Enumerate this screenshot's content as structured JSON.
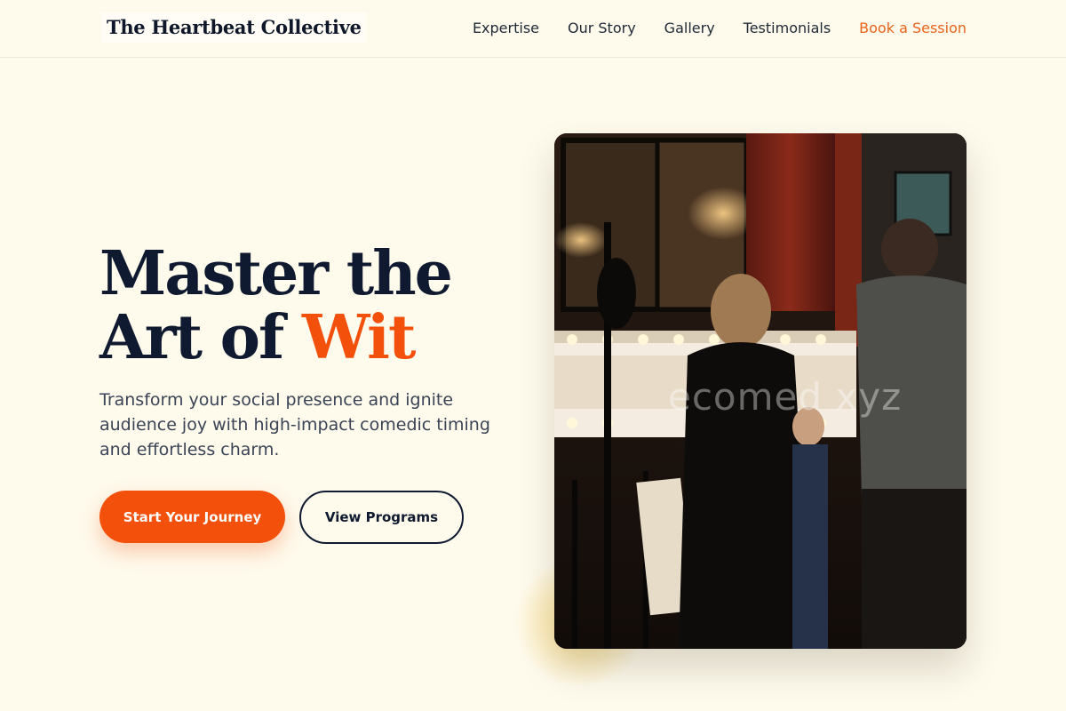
{
  "brand": {
    "name": "The Heartbeat Collective"
  },
  "nav": {
    "items": [
      {
        "label": "Expertise"
      },
      {
        "label": "Our Story"
      },
      {
        "label": "Gallery"
      },
      {
        "label": "Testimonials"
      },
      {
        "label": "Book a Session"
      }
    ]
  },
  "hero": {
    "title_line1": "Master the",
    "title_line2_prefix": "Art of",
    "title_accent": "Wit",
    "subtitle": "Transform your social presence and ignite audience joy with high-impact comedic timing and effortless charm.",
    "primary_button": "Start Your Journey",
    "secondary_button": "View Programs"
  },
  "photo": {
    "watermark": "ecomed  xyz"
  },
  "colors": {
    "background": "#fefaec",
    "accent": "#f2500b",
    "nav_accent": "#e8641b",
    "text_dark": "#0f1a30",
    "glow": "#facc3c"
  }
}
